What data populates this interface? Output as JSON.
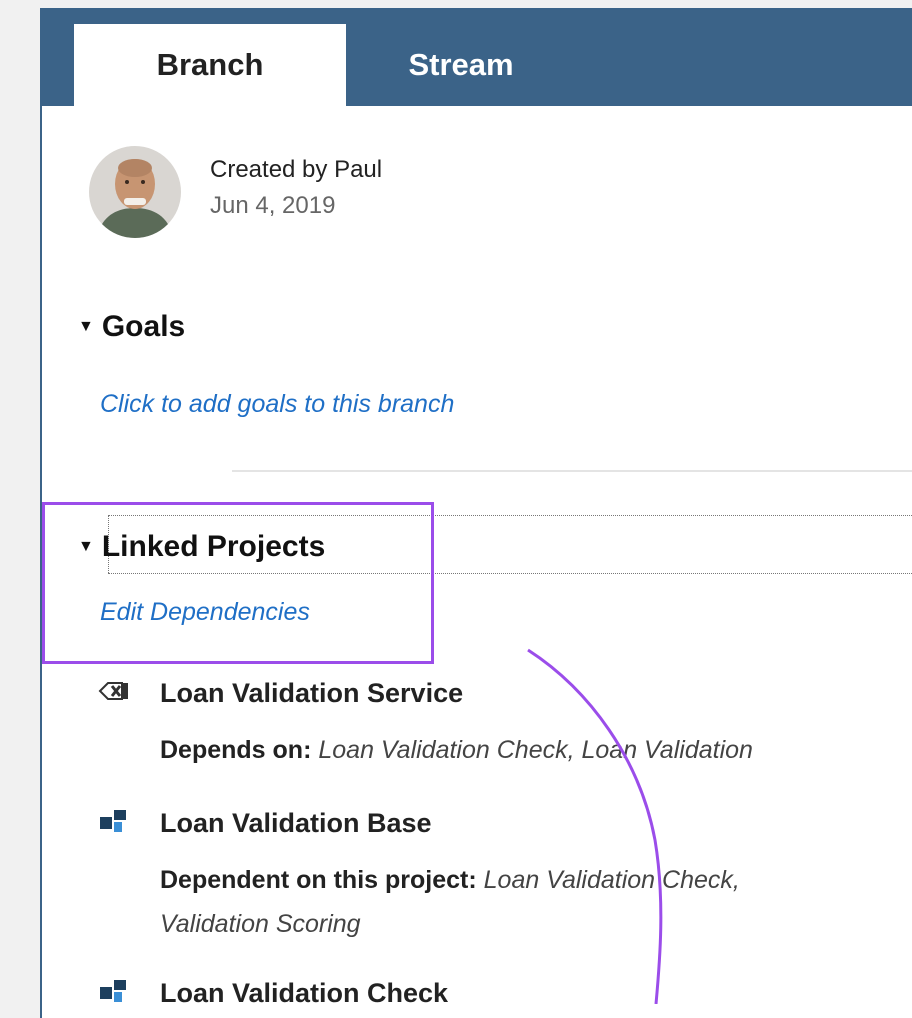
{
  "tabs": [
    {
      "label": "Branch",
      "active": true
    },
    {
      "label": "Stream",
      "active": false
    }
  ],
  "creator": {
    "created_by": "Created by Paul",
    "date": "Jun 4, 2019"
  },
  "goals": {
    "heading": "Goals",
    "add_link": "Click to add goals to this branch"
  },
  "linked_projects": {
    "heading": "Linked Projects",
    "edit_link": "Edit Dependencies",
    "projects": [
      {
        "name": "Loan Validation Service",
        "icon": "service-icon",
        "dep_label": "Depends on:",
        "dep_values": "Loan Validation Check, Loan Validation",
        "dep_values_cont": ""
      },
      {
        "name": "Loan Validation Base",
        "icon": "project-blocks-icon",
        "dep_label": "Dependent on this project:",
        "dep_values": "Loan Validation Check,",
        "dep_values_cont": "Validation Scoring"
      },
      {
        "name": "Loan Validation Check",
        "icon": "project-blocks-icon",
        "dep_label": "",
        "dep_values": "",
        "dep_values_cont": ""
      }
    ]
  },
  "colors": {
    "tab_bar": "#3b6388",
    "link": "#1f6fc6",
    "highlight": "#9b4dea"
  }
}
